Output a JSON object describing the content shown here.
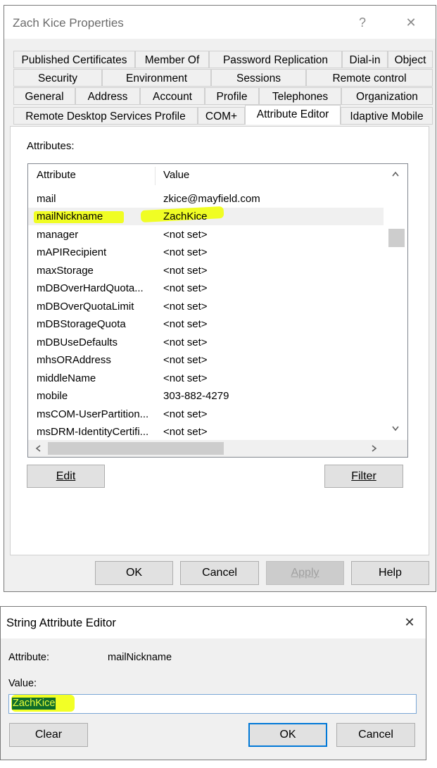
{
  "props_window": {
    "title": "Zach Kice Properties",
    "help_glyph": "?",
    "close_glyph": "✕",
    "tab_rows": [
      [
        "Published Certificates",
        "Member Of",
        "Password Replication",
        "Dial-in",
        "Object"
      ],
      [
        "Security",
        "Environment",
        "Sessions",
        "Remote control"
      ],
      [
        "General",
        "Address",
        "Account",
        "Profile",
        "Telephones",
        "Organization"
      ],
      [
        "Remote Desktop Services Profile",
        "COM+",
        "Attribute Editor",
        "Idaptive Mobile"
      ]
    ],
    "active_tab": "Attribute Editor",
    "attributes_label": "Attributes:",
    "columns": [
      "Attribute",
      "Value"
    ],
    "rows": [
      {
        "attribute": "mail",
        "value": "zkice@mayfield.com"
      },
      {
        "attribute": "mailNickname",
        "value": "ZachKice"
      },
      {
        "attribute": "manager",
        "value": "<not set>"
      },
      {
        "attribute": "mAPIRecipient",
        "value": "<not set>"
      },
      {
        "attribute": "maxStorage",
        "value": "<not set>"
      },
      {
        "attribute": "mDBOverHardQuota...",
        "value": "<not set>"
      },
      {
        "attribute": "mDBOverQuotaLimit",
        "value": "<not set>"
      },
      {
        "attribute": "mDBStorageQuota",
        "value": "<not set>"
      },
      {
        "attribute": "mDBUseDefaults",
        "value": "<not set>"
      },
      {
        "attribute": "mhsORAddress",
        "value": "<not set>"
      },
      {
        "attribute": "middleName",
        "value": "<not set>"
      },
      {
        "attribute": "mobile",
        "value": "303-882-4279"
      },
      {
        "attribute": "msCOM-UserPartition...",
        "value": "<not set>"
      },
      {
        "attribute": "msDRM-IdentityCertifi...",
        "value": "<not set>"
      }
    ],
    "highlighted_row": "mailNickname",
    "edit_button": "Edit",
    "filter_button": "Filter",
    "ok_button": "OK",
    "cancel_button": "Cancel",
    "apply_button": "Apply",
    "help_button": "Help"
  },
  "string_editor": {
    "title": "String Attribute Editor",
    "close_glyph": "✕",
    "attribute_label": "Attribute:",
    "attribute_value": "mailNickname",
    "value_label": "Value:",
    "value": "ZachKice",
    "clear_button": "Clear",
    "ok_button": "OK",
    "cancel_button": "Cancel"
  },
  "colors": {
    "highlighter": "#f0ff00",
    "selection": "#0078d7",
    "dialog_bg": "#f0f0f0"
  }
}
